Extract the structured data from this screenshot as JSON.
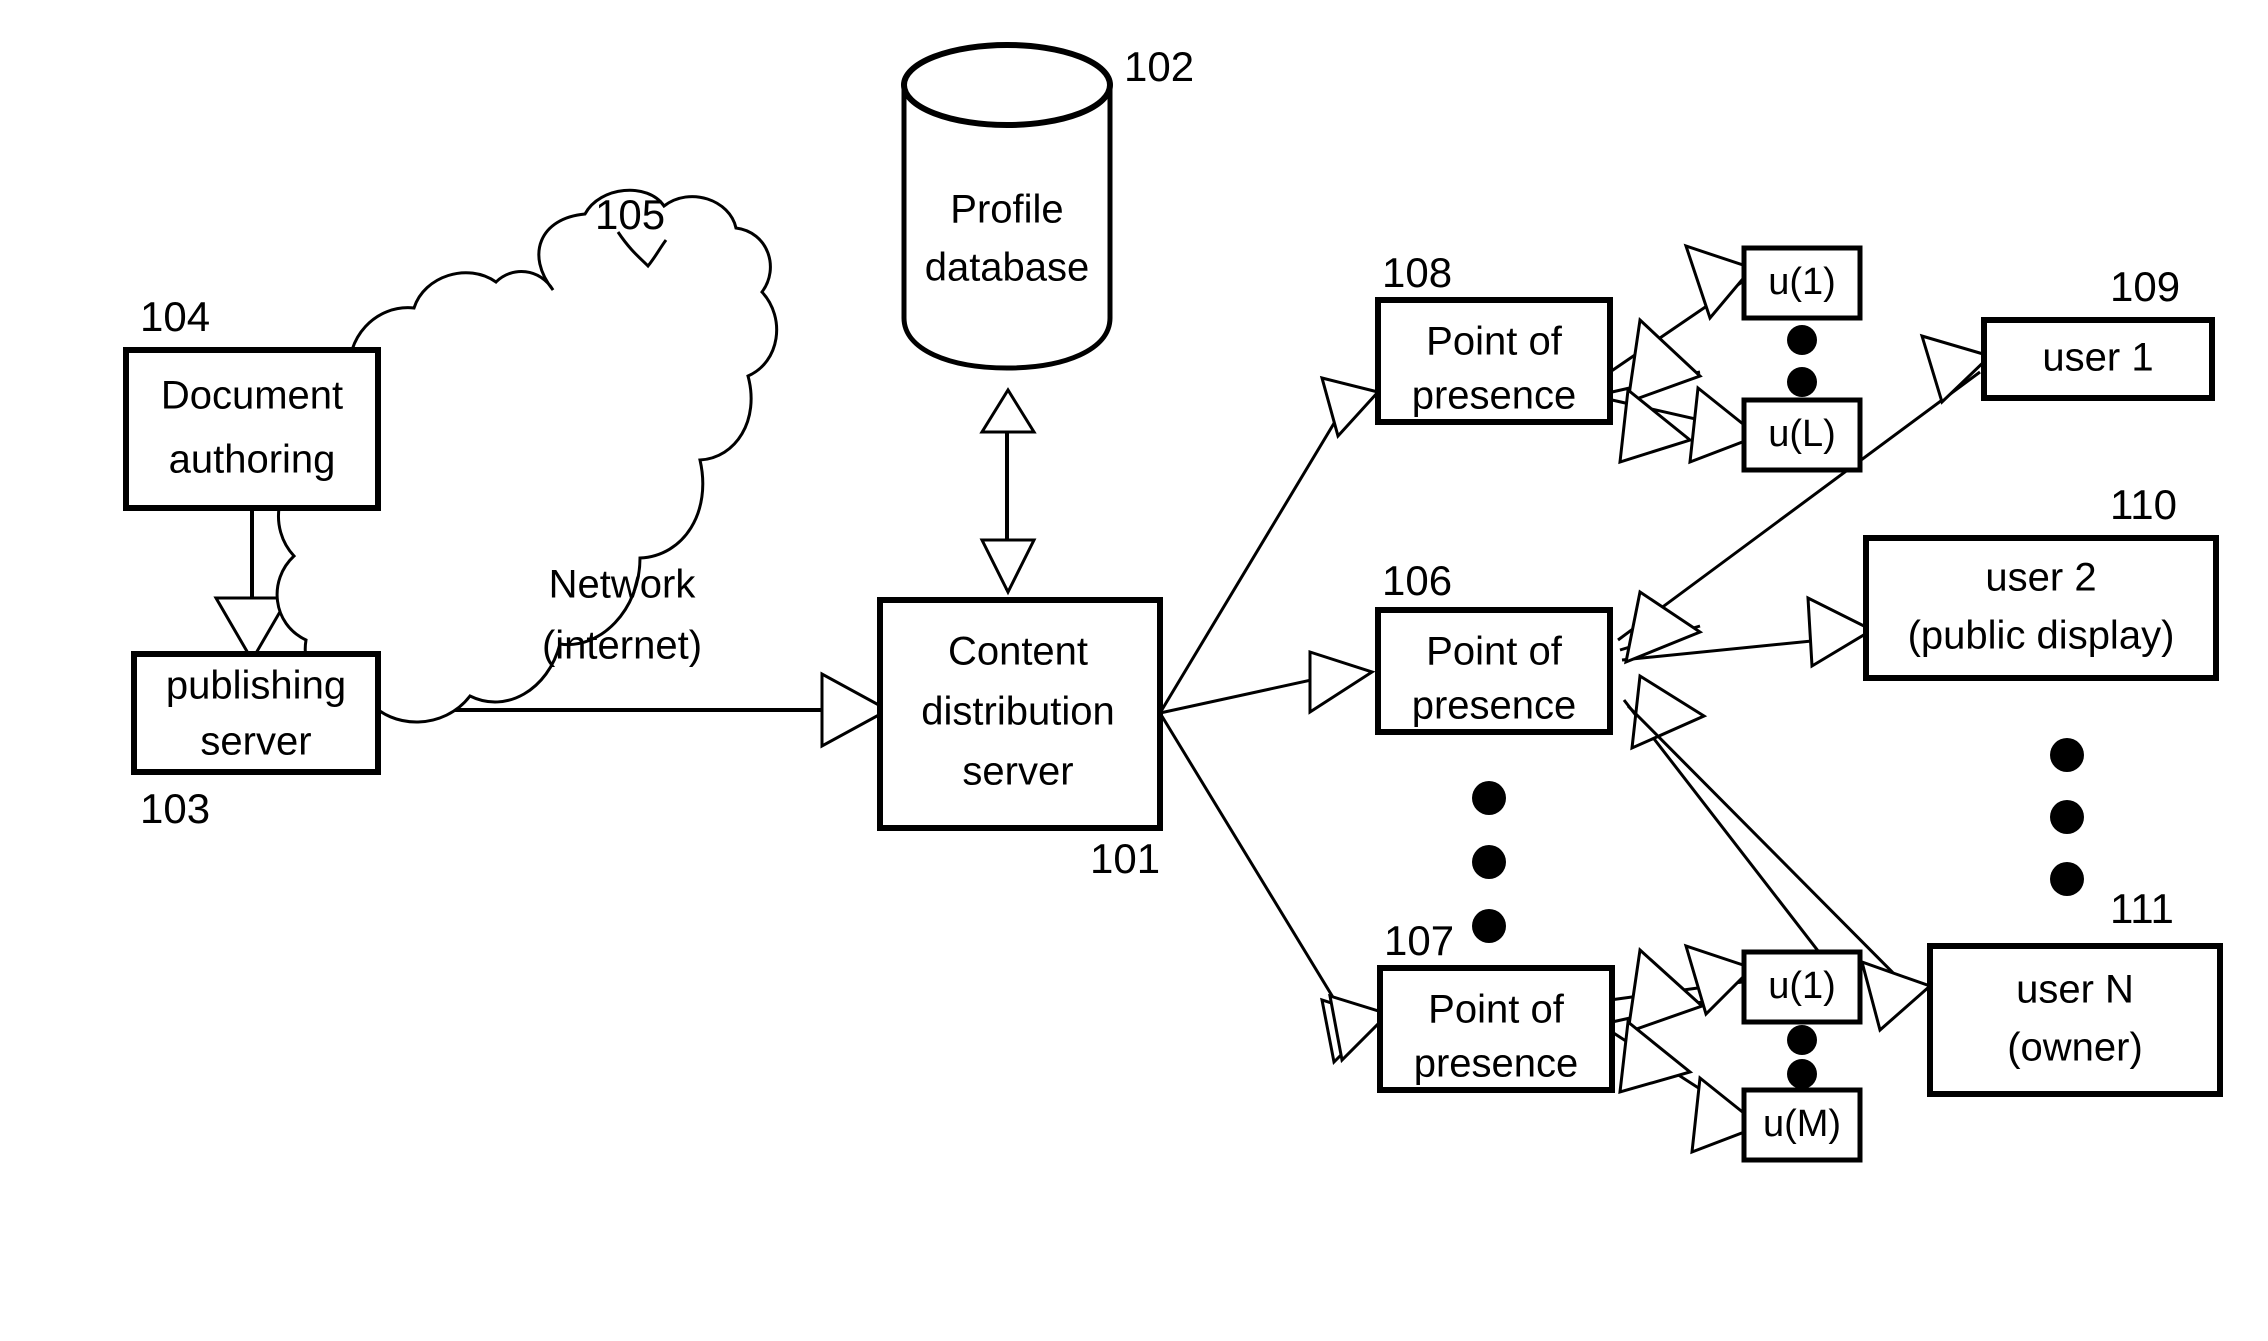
{
  "figure": {
    "type": "patent-block-diagram",
    "background": "#ffffff",
    "line_color": "#000000"
  },
  "nodes": {
    "document_authoring": {
      "ref": "104",
      "line1": "Document",
      "line2": "authoring"
    },
    "publishing_server": {
      "ref": "103",
      "line1": "publishing",
      "line2": "server"
    },
    "network": {
      "ref": "105",
      "line1": "Network",
      "line2": "(internet)"
    },
    "profile_database": {
      "ref": "102",
      "line1": "Profile",
      "line2": "database"
    },
    "content_distribution_server": {
      "ref": "101",
      "line1": "Content",
      "line2": "distribution",
      "line3": "server"
    },
    "pop_108": {
      "ref": "108",
      "line1": "Point of",
      "line2": "presence"
    },
    "pop_106": {
      "ref": "106",
      "line1": "Point of",
      "line2": "presence"
    },
    "pop_107": {
      "ref": "107",
      "line1": "Point of",
      "line2": "presence"
    },
    "u1_top": {
      "label": "u(1)"
    },
    "uL": {
      "label": "u(L)"
    },
    "u1_bottom": {
      "label": "u(1)"
    },
    "uM": {
      "label": "u(M)"
    },
    "user_1": {
      "ref": "109",
      "line1": "user 1"
    },
    "user_2": {
      "ref": "110",
      "line1": "user 2",
      "line2": "(public display)"
    },
    "user_n": {
      "ref": "111",
      "line1": "user N",
      "line2": "(owner)"
    }
  },
  "ellipses": {
    "pop_column": "vertical ellipsis between point of presence 106 and 107",
    "user_column": "vertical ellipsis between user 2 and user N",
    "u_top_column": "vertical ellipsis between u(1) and u(L)",
    "u_bottom_column": "vertical ellipsis between u(1) and u(M)"
  }
}
